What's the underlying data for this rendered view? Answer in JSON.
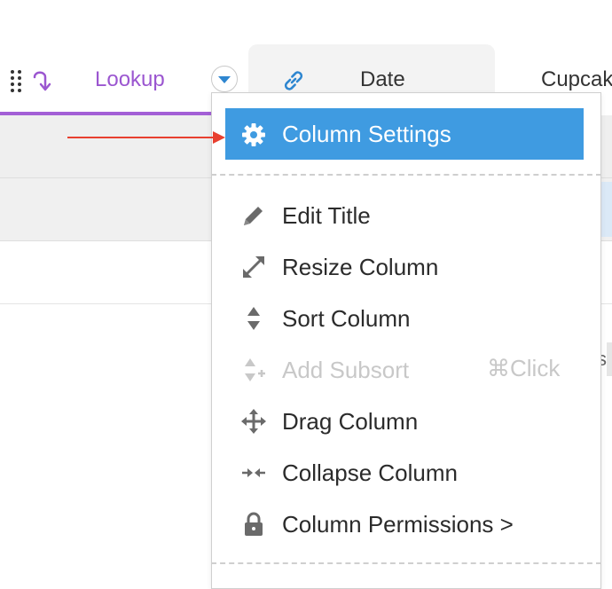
{
  "header": {
    "lookup_label": "Lookup",
    "date_label": "Date",
    "cupcake_label": "Cupcak"
  },
  "menu": {
    "active_item": "Column Settings",
    "items": [
      {
        "label": "Edit Title",
        "icon": "pencil-icon",
        "disabled": false
      },
      {
        "label": "Resize Column",
        "icon": "resize-icon",
        "disabled": false
      },
      {
        "label": "Sort Column",
        "icon": "sort-icon",
        "disabled": false
      },
      {
        "label": "Add Subsort",
        "icon": "subsort-icon",
        "disabled": true,
        "shortcut": "⌘Click"
      },
      {
        "label": "Drag Column",
        "icon": "move-icon",
        "disabled": false
      },
      {
        "label": "Collapse Column",
        "icon": "collapse-icon",
        "disabled": false
      },
      {
        "label": "Column Permissions >",
        "icon": "lock-icon",
        "disabled": false
      }
    ]
  },
  "background": {
    "stub_text": "s"
  },
  "colors": {
    "accent_purple": "#9b56d0",
    "menu_active_blue": "#3f9be1",
    "annotation_red": "#e8402f",
    "link_blue": "#2e86d0"
  }
}
